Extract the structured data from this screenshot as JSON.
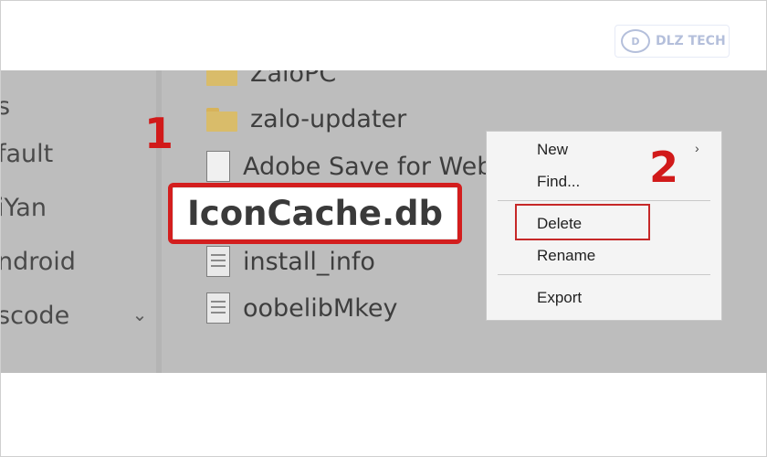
{
  "watermark": {
    "logo_text": "D",
    "brand": "DLZ TECH"
  },
  "sidebar": {
    "items": [
      "s",
      "fault",
      "iYan",
      "ndroid",
      "scode"
    ]
  },
  "files": [
    {
      "name": "ZaloPC",
      "icon": "folder-icon"
    },
    {
      "name": "zalo-updater",
      "icon": "folder-icon"
    },
    {
      "name": "Adobe Save for Web",
      "icon": "document-icon"
    },
    {
      "name": "install_info",
      "icon": "text-file-icon"
    },
    {
      "name": "oobelibMkey",
      "icon": "text-file-icon"
    }
  ],
  "highlighted_file": "IconCache.db",
  "steps": {
    "one": "1",
    "two": "2"
  },
  "context_menu": {
    "items": [
      "New",
      "Find...",
      "Delete",
      "Rename",
      "Export"
    ],
    "submenu_arrow": "›"
  },
  "colors": {
    "highlight": "#d31e1e",
    "explorer_overlay": "#bdbdbd",
    "folder": "#d9bc6a"
  }
}
